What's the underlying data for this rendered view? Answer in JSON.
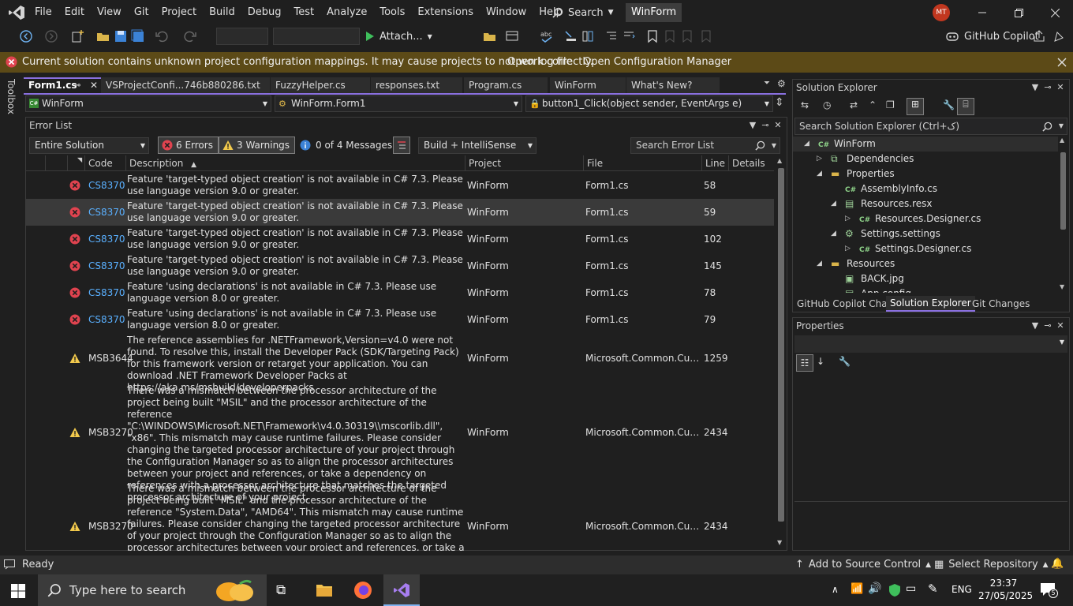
{
  "menu": {
    "items": [
      "File",
      "Edit",
      "View",
      "Git",
      "Project",
      "Build",
      "Debug",
      "Test",
      "Analyze",
      "Tools",
      "Extensions",
      "Window",
      "Help"
    ],
    "search_label": "Search",
    "solution_name": "WinForm",
    "avatar_initials": "MT"
  },
  "toolbar": {
    "attach_label": "Attach...",
    "copilot_label": "GitHub Copilot"
  },
  "infobar": {
    "message": "Current solution contains unknown project configuration mappings. It may cause projects to not work correctly.",
    "link_log": "Open log file",
    "link_config": "Open Configuration Manager"
  },
  "toolbox_label": "Toolbox",
  "doc_tabs": [
    "Form1.cs",
    "VSProjectConfi...746b880286.txt",
    "FuzzyHelper.cs",
    "responses.txt",
    "Program.cs",
    "WinForm",
    "What's New?"
  ],
  "navbar": {
    "project": "WinForm",
    "type": "WinForm.Form1",
    "member": "button1_Click(object sender, EventArgs e)"
  },
  "error_list": {
    "title": "Error List",
    "scope": "Entire Solution",
    "errors_filter": "6 Errors",
    "warnings_filter": "3 Warnings",
    "messages_filter": "0 of 4 Messages",
    "source": "Build + IntelliSense",
    "search_placeholder": "Search Error List",
    "columns": [
      "Code",
      "Description",
      "Project",
      "File",
      "Line",
      "Details"
    ],
    "rows": [
      {
        "type": "error",
        "code": "CS8370",
        "description": "Feature 'target-typed object creation' is not available in C# 7.3. Please use language version 9.0 or greater.",
        "project": "WinForm",
        "file": "Form1.cs",
        "line": "58"
      },
      {
        "type": "error",
        "code": "CS8370",
        "description": "Feature 'target-typed object creation' is not available in C# 7.3. Please use language version 9.0 or greater.",
        "project": "WinForm",
        "file": "Form1.cs",
        "line": "59"
      },
      {
        "type": "error",
        "code": "CS8370",
        "description": "Feature 'target-typed object creation' is not available in C# 7.3. Please use language version 9.0 or greater.",
        "project": "WinForm",
        "file": "Form1.cs",
        "line": "102"
      },
      {
        "type": "error",
        "code": "CS8370",
        "description": "Feature 'target-typed object creation' is not available in C# 7.3. Please use language version 9.0 or greater.",
        "project": "WinForm",
        "file": "Form1.cs",
        "line": "145"
      },
      {
        "type": "error",
        "code": "CS8370",
        "description": "Feature 'using declarations' is not available in C# 7.3. Please use language version 8.0 or greater.",
        "project": "WinForm",
        "file": "Form1.cs",
        "line": "78"
      },
      {
        "type": "error",
        "code": "CS8370",
        "description": "Feature 'using declarations' is not available in C# 7.3. Please use language version 8.0 or greater.",
        "project": "WinForm",
        "file": "Form1.cs",
        "line": "79"
      },
      {
        "type": "warning",
        "code": "MSB3644",
        "description": "The reference assemblies for .NETFramework,Version=v4.0 were not found. To resolve this, install the Developer Pack (SDK/Targeting Pack) for this framework version or retarget your application. You can download .NET Framework Developer Packs at https://aka.ms/msbuild/developerpacks",
        "project": "WinForm",
        "file": "Microsoft.Common.Curre...",
        "line": "1259"
      },
      {
        "type": "warning",
        "code": "MSB3270",
        "description": "There was a mismatch between the processor architecture of the project being built \"MSIL\" and the processor architecture of the reference \"C:\\WINDOWS\\Microsoft.NET\\Framework\\v4.0.30319\\\\mscorlib.dll\", \"x86\". This mismatch may cause runtime failures. Please consider changing the targeted processor architecture of your project through the Configuration Manager so as to align the processor architectures between your project and references, or take a dependency on references with a processor architecture that matches the targeted processor architecture of your project.",
        "project": "WinForm",
        "file": "Microsoft.Common.Curre...",
        "line": "2434"
      },
      {
        "type": "warning",
        "code": "MSB3270",
        "description": "There was a mismatch between the processor architecture of the project being built \"MSIL\" and the processor architecture of the reference \"System.Data\", \"AMD64\". This mismatch may cause runtime failures. Please consider changing the targeted processor architecture of your project through the Configuration Manager so as to align the processor architectures between your project and references, or take a dependency on references with a processor architecture that",
        "project": "WinForm",
        "file": "Microsoft.Common.Curre...",
        "line": "2434"
      }
    ]
  },
  "solution_explorer": {
    "title": "Solution Explorer",
    "search_placeholder": "Search Solution Explorer (Ctrl+ک)",
    "tree": [
      {
        "label": "WinForm",
        "icon": "csharp-project-icon"
      },
      {
        "label": "Dependencies",
        "icon": "dependencies-icon"
      },
      {
        "label": "Properties",
        "icon": "folder-icon"
      },
      {
        "label": "AssemblyInfo.cs",
        "icon": "csharp-file-icon"
      },
      {
        "label": "Resources.resx",
        "icon": "resx-icon"
      },
      {
        "label": "Resources.Designer.cs",
        "icon": "csharp-file-icon"
      },
      {
        "label": "Settings.settings",
        "icon": "settings-file-icon"
      },
      {
        "label": "Settings.Designer.cs",
        "icon": "csharp-file-icon"
      },
      {
        "label": "Resources",
        "icon": "folder-icon"
      },
      {
        "label": "BACK.jpg",
        "icon": "image-file-icon"
      },
      {
        "label": "App.config",
        "icon": "config-file-icon"
      }
    ],
    "tabs": [
      "GitHub Copilot Chat",
      "Solution Explorer",
      "Git Changes"
    ]
  },
  "properties": {
    "title": "Properties"
  },
  "statusbar": {
    "ready": "Ready",
    "source_control": "Add to Source Control",
    "repository": "Select Repository"
  },
  "taskbar": {
    "search_placeholder": "Type here to search",
    "language": "ENG",
    "time": "23:37",
    "date": "27/05/2025",
    "notifications": "5"
  },
  "colors": {
    "accent": "#8a70e0",
    "error": "#e0434f",
    "warning": "#f2c94c",
    "infobar": "#5c4a17"
  }
}
